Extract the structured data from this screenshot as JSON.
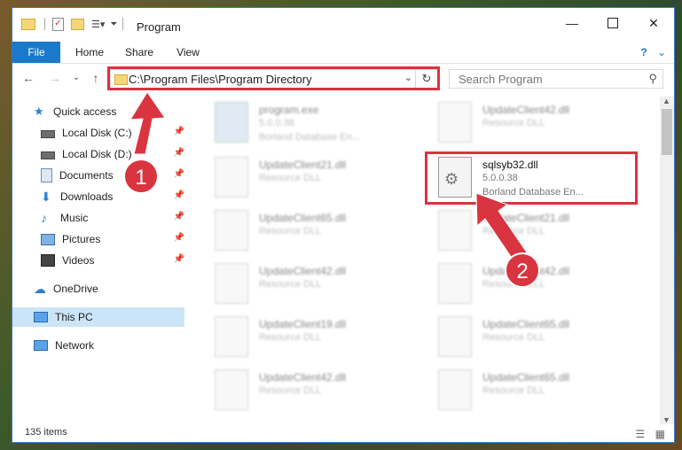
{
  "window": {
    "title": "Program",
    "controls": [
      "minimize-icon",
      "maximize-icon",
      "close-icon"
    ]
  },
  "ribbon": {
    "tabs": [
      {
        "label": "File"
      },
      {
        "label": "Home"
      },
      {
        "label": "Share"
      },
      {
        "label": "View"
      }
    ],
    "help": "?"
  },
  "nav": {
    "address": "C:\\Program Files\\Program Directory",
    "search_placeholder": "Search Program"
  },
  "sidebar": {
    "items": [
      {
        "label": "Quick access",
        "icon": "star-icon"
      },
      {
        "label": "Local Disk (C:)",
        "icon": "drive-icon",
        "pinned": true
      },
      {
        "label": "Local Disk (D:)",
        "icon": "drive-icon",
        "pinned": true
      },
      {
        "label": "Documents",
        "icon": "documents-icon",
        "pinned": true
      },
      {
        "label": "Downloads",
        "icon": "downloads-icon",
        "pinned": true
      },
      {
        "label": "Music",
        "icon": "music-icon",
        "pinned": true
      },
      {
        "label": "Pictures",
        "icon": "pictures-icon",
        "pinned": true
      },
      {
        "label": "Videos",
        "icon": "videos-icon",
        "pinned": true
      },
      {
        "label": "OneDrive",
        "icon": "cloud-icon"
      },
      {
        "label": "This PC",
        "icon": "computer-icon",
        "selected": true
      },
      {
        "label": "Network",
        "icon": "network-icon"
      }
    ]
  },
  "files": {
    "highlighted": {
      "name": "sqlsyb32.dll",
      "version": "5.0.0.38",
      "description": "Borland Database En..."
    },
    "others": [
      {
        "name": "program.exe",
        "line2": "5.0.0.38",
        "line3": "Borland Database En..."
      },
      {
        "name": "UpdateClient42.dll",
        "line2": "Resource DLL"
      },
      {
        "name": "UpdateClient21.dll",
        "line2": "Resource DLL"
      },
      {
        "name": "UpdateClient65.dll",
        "line2": "Resource DLL"
      },
      {
        "name": "UpdateClient21.dll",
        "line2": "Resource DLL"
      },
      {
        "name": "UpdateClient42.dll",
        "line2": "Resource DLL"
      },
      {
        "name": "UpdateClient42.dll",
        "line2": "Resource DLL"
      },
      {
        "name": "UpdateClient19.dll",
        "line2": "Resource DLL"
      },
      {
        "name": "UpdateClient65.dll",
        "line2": "Resource DLL"
      },
      {
        "name": "UpdateClient42.dll",
        "line2": "Resource DLL"
      },
      {
        "name": "UpdateClient65.dll",
        "line2": "Resource DLL"
      }
    ]
  },
  "status": {
    "item_count": "135 items"
  },
  "annotations": {
    "step1": "1",
    "step2": "2",
    "color": "#d9343f"
  }
}
